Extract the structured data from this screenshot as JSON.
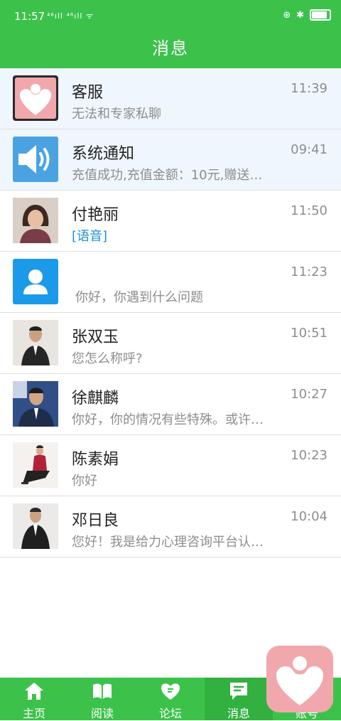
{
  "status": {
    "time": "11:57",
    "signal": "⁴⁶ıll ⁴⁶ıll ᯤ"
  },
  "header": {
    "title": "消息"
  },
  "messages": [
    {
      "name": "客服",
      "preview": "无法和专家私聊",
      "time": "11:39",
      "avatar": "heart-logo"
    },
    {
      "name": "系统通知",
      "preview": "充值成功,充值金额：10元,赠送…",
      "time": "09:41",
      "avatar": "speaker"
    },
    {
      "name": "付艳丽",
      "preview": "[语音]",
      "time": "11:50",
      "avatar": "photo"
    },
    {
      "name": "",
      "preview": "你好，你遇到什么问题",
      "time": "11:23",
      "avatar": "default-user"
    },
    {
      "name": "张双玉",
      "preview": "您怎么称呼?",
      "time": "10:51",
      "avatar": "photo"
    },
    {
      "name": "徐麒麟",
      "preview": "你好，你的情况有些特殊。或许…",
      "time": "10:27",
      "avatar": "photo"
    },
    {
      "name": "陈素娟",
      "preview": "你好",
      "time": "10:23",
      "avatar": "photo"
    },
    {
      "name": "邓日良",
      "preview": "您好！我是给力心理咨询平台认…",
      "time": "10:04",
      "avatar": "photo"
    }
  ],
  "tabs": [
    {
      "label": "主页",
      "icon": "home-icon"
    },
    {
      "label": "阅读",
      "icon": "book-icon"
    },
    {
      "label": "论坛",
      "icon": "forum-icon"
    },
    {
      "label": "消息",
      "icon": "message-icon",
      "active": true
    },
    {
      "label": "账号",
      "icon": "account-icon"
    }
  ],
  "colors": {
    "primary": "#3cc24b",
    "pinned_bg": "#eff6fd",
    "logo_pink": "#f1a8ad",
    "notify_blue": "#4aa3e0"
  }
}
